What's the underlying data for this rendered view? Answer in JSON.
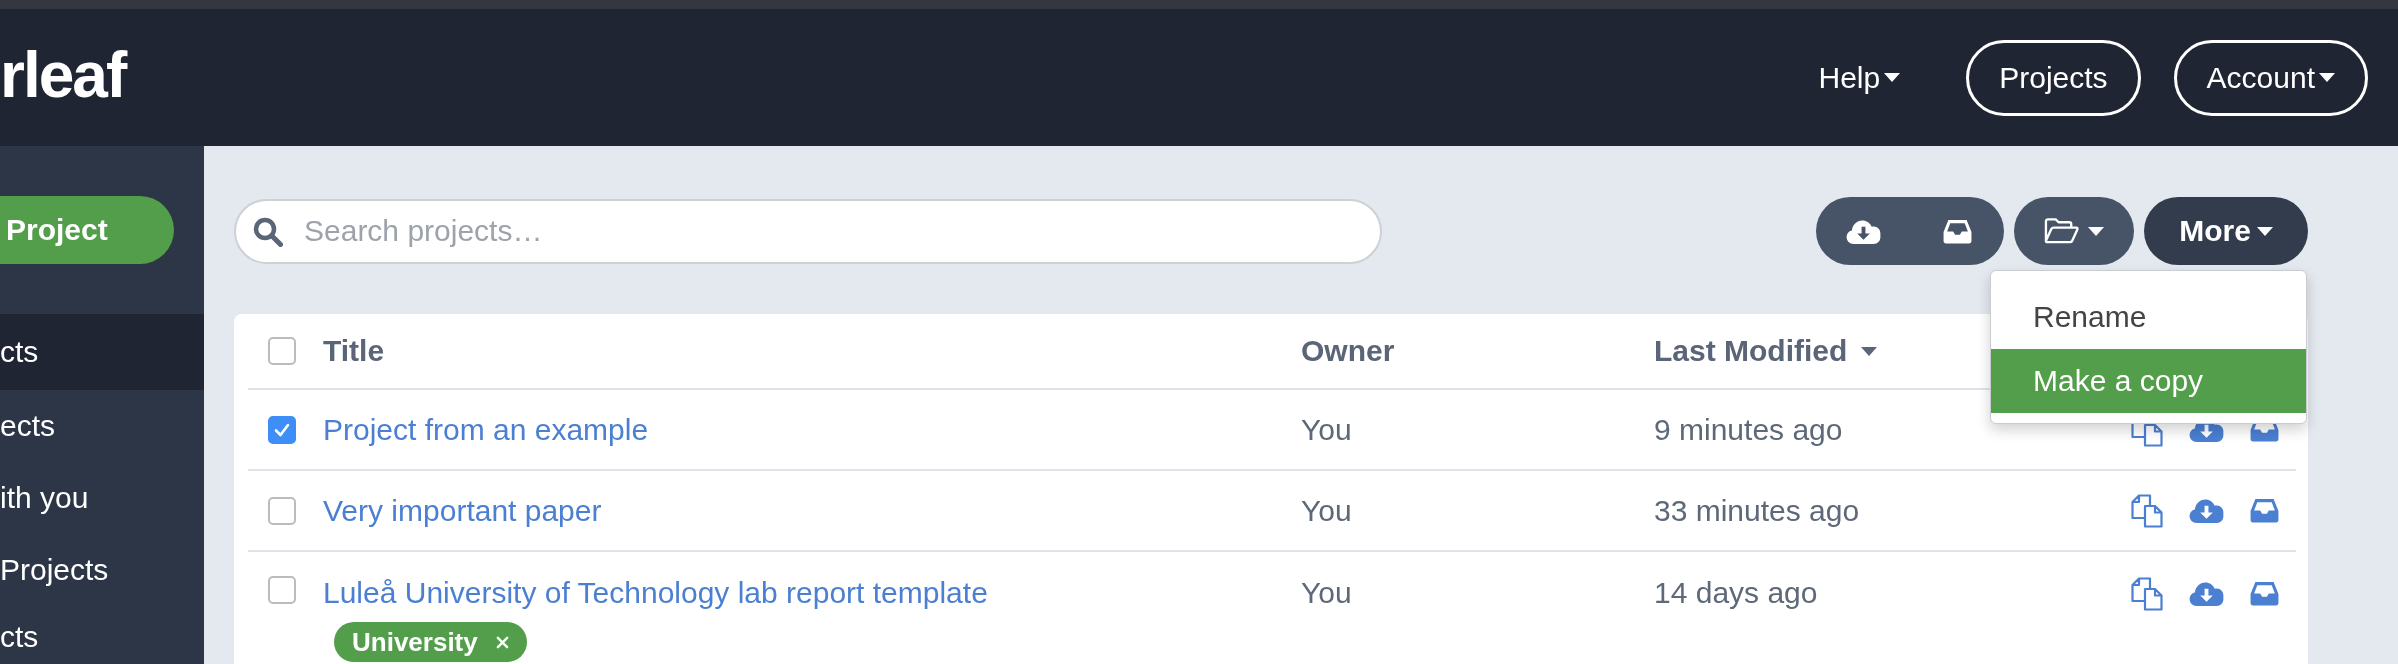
{
  "header": {
    "logo": "rleaf",
    "nav": [
      {
        "kind": "link",
        "label": "Help",
        "caret": true
      },
      {
        "kind": "pill",
        "label": "Projects",
        "caret": false
      },
      {
        "kind": "pill",
        "label": "Account",
        "caret": true
      }
    ]
  },
  "sidebar": {
    "new_button": "Project",
    "items": [
      {
        "label": "cts",
        "selected": true
      },
      {
        "label": "ects",
        "selected": false
      },
      {
        "label": "ith you",
        "selected": false
      },
      {
        "label": "Projects",
        "selected": false
      },
      {
        "label": "cts",
        "selected": false
      }
    ]
  },
  "search": {
    "placeholder": "Search projects…"
  },
  "toolbar": {
    "more": {
      "label": "More",
      "caret": true,
      "expanded": true,
      "menu": [
        {
          "label": "Rename",
          "selected": false
        },
        {
          "label": "Make a copy",
          "selected": true
        }
      ]
    }
  },
  "table": {
    "select_all": {
      "checked": false
    },
    "columns": [
      {
        "label": "Title",
        "sorted": false
      },
      {
        "label": "Owner",
        "sorted": false
      },
      {
        "label": "Last Modified",
        "sorted": true
      }
    ],
    "rows": [
      {
        "checked": true,
        "title": "Project from an example",
        "owner": "You",
        "modified": "9 minutes ago"
      },
      {
        "checked": false,
        "title": "Very important paper",
        "owner": "You",
        "modified": "33 minutes ago"
      },
      {
        "checked": false,
        "title": "Luleå University of Technology lab report template",
        "owner": "You",
        "modified": "14 days ago",
        "tags": [
          {
            "label": "University",
            "color": "#529e4a"
          }
        ]
      }
    ]
  }
}
